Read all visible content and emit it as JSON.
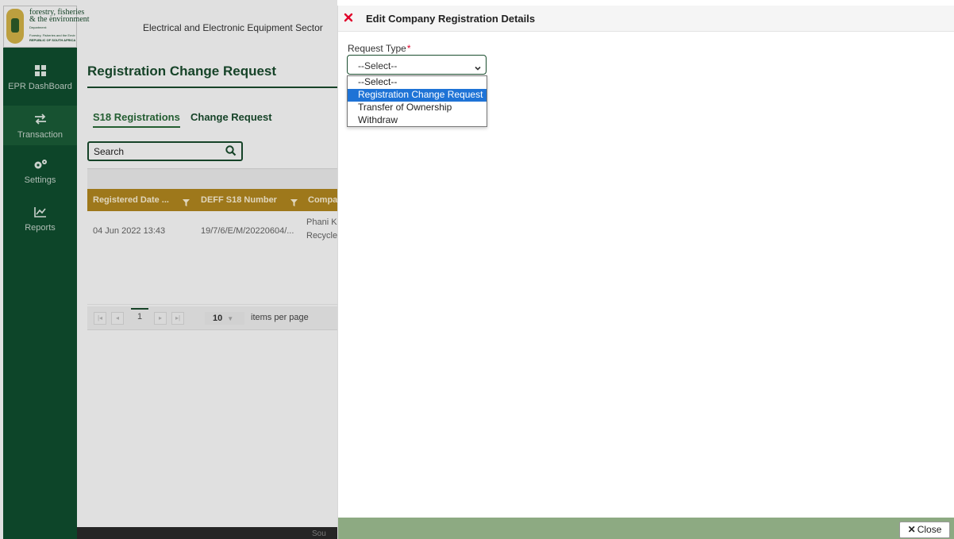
{
  "brand": {
    "line1": "forestry, fisheries",
    "line2": "& the environment",
    "line3": "Department:",
    "line4": "Forestry, Fisheries and the Environment",
    "line5": "REPUBLIC OF SOUTH AFRICA"
  },
  "header": {
    "sector": "Electrical and Electronic Equipment Sector"
  },
  "sidebar": {
    "items": [
      {
        "label": "EPR DashBoard",
        "icon": "dashboard-icon"
      },
      {
        "label": "Transaction",
        "icon": "swap-arrows-icon"
      },
      {
        "label": "Settings",
        "icon": "gears-icon"
      },
      {
        "label": "Reports",
        "icon": "line-chart-icon"
      }
    ]
  },
  "main": {
    "title": "Registration Change Request",
    "tabs": [
      {
        "label": "S18 Registrations"
      },
      {
        "label": "Change Request"
      }
    ],
    "search": {
      "placeholder": "Search"
    },
    "grid": {
      "columns": [
        "Registered Date ...",
        "DEFF S18 Number",
        "Compa"
      ],
      "rows": [
        {
          "date": "04 Jun 2022 13:43",
          "number": "19/7/6/E/M/20220604/...",
          "company_line1": "Phani K",
          "company_line2": "Recycle"
        }
      ]
    },
    "pager": {
      "current_page": "1",
      "page_size": "10",
      "items_label": "items per page"
    },
    "footer_text": "Sou"
  },
  "drawer": {
    "title": "Edit Company Registration Details",
    "field": {
      "label": "Request Type",
      "required_mark": "*",
      "value": "--Select--",
      "options": [
        "--Select--",
        "Registration Change Request",
        "Transfer of Ownership",
        "Withdraw"
      ],
      "highlighted_index": 1
    },
    "close_label": "Close",
    "colors": {
      "footer": "#8daa82",
      "highlight": "#1e73d6",
      "close_x": "#e0002a"
    }
  }
}
